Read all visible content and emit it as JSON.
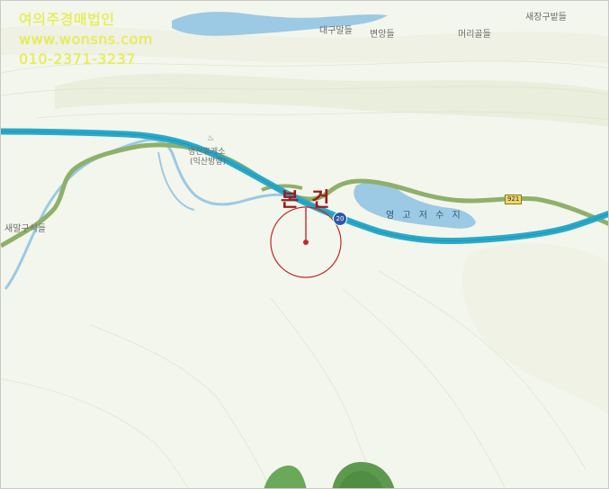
{
  "watermark": {
    "company": "여의주경매법인",
    "website": "www.wonsns.com",
    "phone": "010-2371-3237"
  },
  "places": {
    "saejang": "새장구밭들",
    "daegu": "대구말들",
    "byeonyang": "변앙들",
    "meori": "머리골들",
    "rest_area": "영천휴게소",
    "rest_area_sub": "(익산방향)",
    "saemal": "새말구석들"
  },
  "lake": {
    "label": "영 고 저 수 지"
  },
  "target": {
    "label": "본건"
  },
  "roads": {
    "national_route": "921",
    "expressway": "20"
  },
  "icons": {
    "poi": "rest-area-icon"
  },
  "colors": {
    "background": "#f3f6ec",
    "water": "#9cc9e4",
    "expressway": "#2aa9c9",
    "national_road": "#8fb06a",
    "target_marker": "#c02a2a",
    "watermark": "#e9f03a",
    "forest": "#5e9a4e"
  }
}
